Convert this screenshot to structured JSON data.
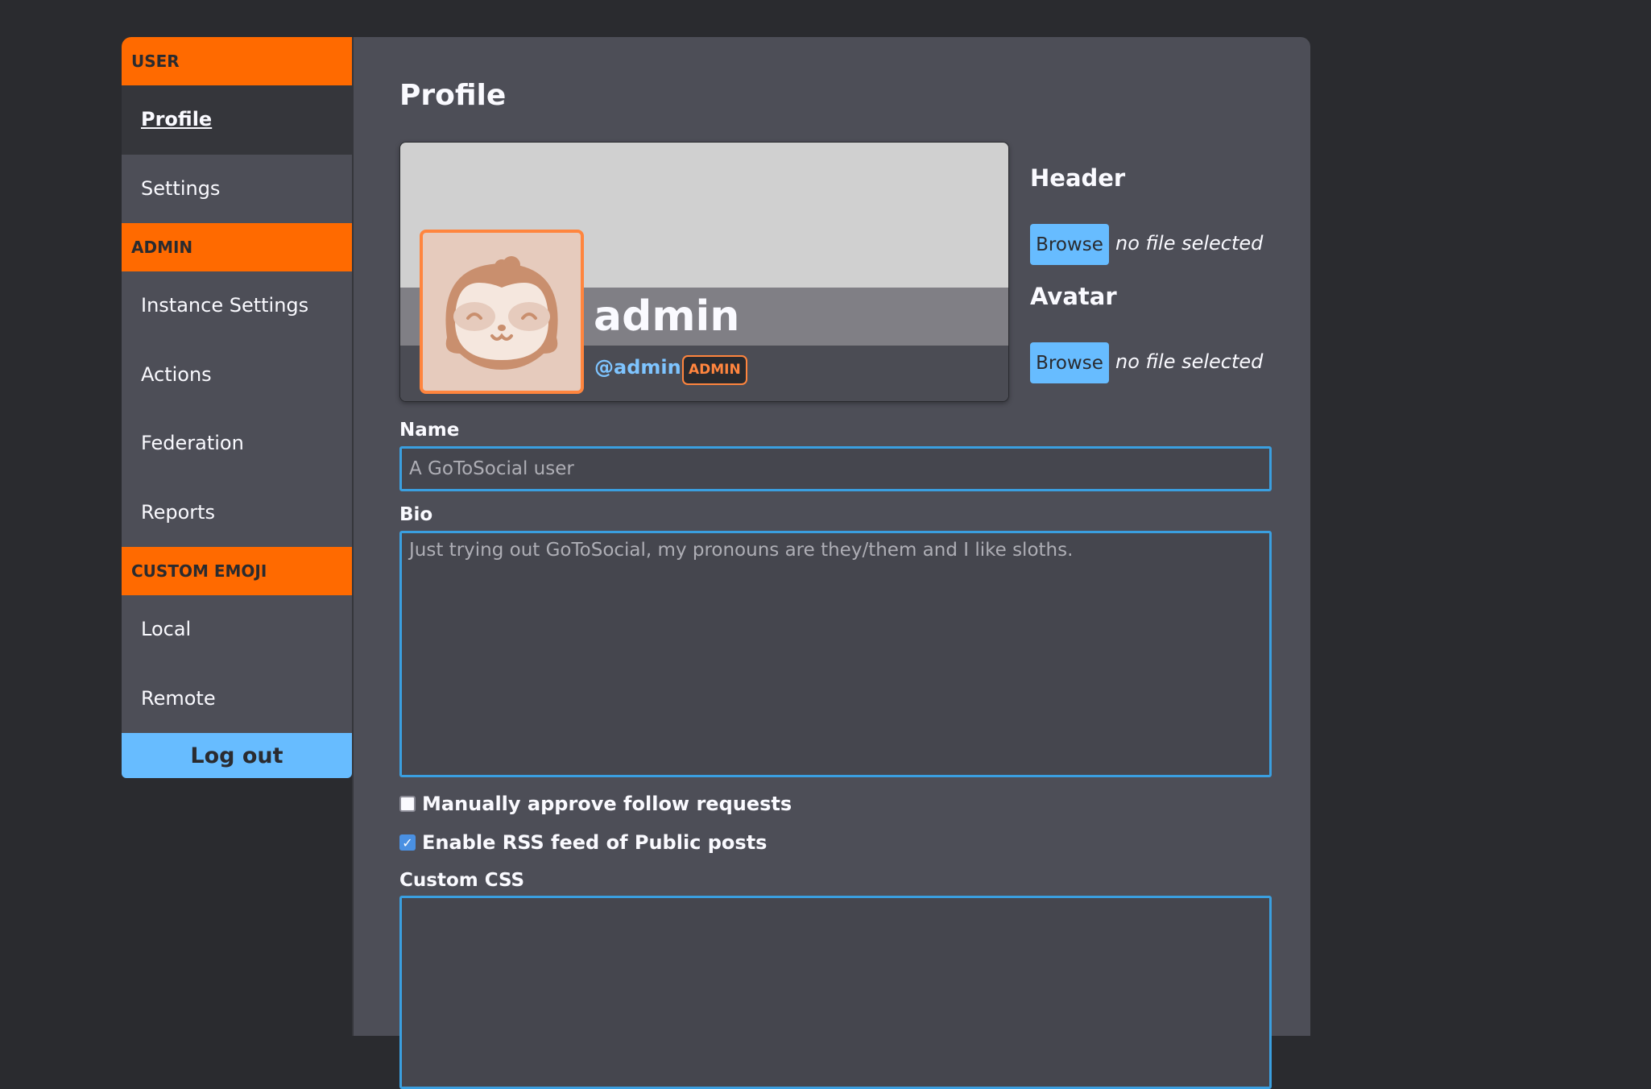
{
  "sidebar": {
    "sections": [
      {
        "title": "USER",
        "items": [
          {
            "label": "Profile",
            "active": true
          },
          {
            "label": "Settings"
          }
        ]
      },
      {
        "title": "ADMIN",
        "items": [
          {
            "label": "Instance Settings"
          },
          {
            "label": "Actions"
          },
          {
            "label": "Federation"
          },
          {
            "label": "Reports"
          }
        ]
      },
      {
        "title": "CUSTOM EMOJI",
        "items": [
          {
            "label": "Local"
          },
          {
            "label": "Remote"
          }
        ]
      }
    ],
    "logout_label": "Log out"
  },
  "main": {
    "title": "Profile",
    "card": {
      "display_name": "admin",
      "username": "@admin",
      "role_badge": "ADMIN"
    },
    "header_upload": {
      "label": "Header",
      "button": "Browse",
      "status": "no file selected"
    },
    "avatar_upload": {
      "label": "Avatar",
      "button": "Browse",
      "status": "no file selected"
    },
    "name": {
      "label": "Name",
      "value": "",
      "placeholder": "A GoToSocial user"
    },
    "bio": {
      "label": "Bio",
      "value": "",
      "placeholder": "Just trying out GoToSocial, my pronouns are they/them and I like sloths."
    },
    "checkboxes": [
      {
        "label": "Manually approve follow requests",
        "checked": false
      },
      {
        "label": "Enable RSS feed of Public posts",
        "checked": true
      }
    ],
    "custom_css": {
      "label": "Custom CSS",
      "value": ""
    }
  },
  "colors": {
    "accent_orange": "#ff6a00",
    "accent_blue": "#67bcff",
    "input_border": "#3a9fe0",
    "background": "#2a2b2f",
    "panel": "#4d4e57"
  }
}
